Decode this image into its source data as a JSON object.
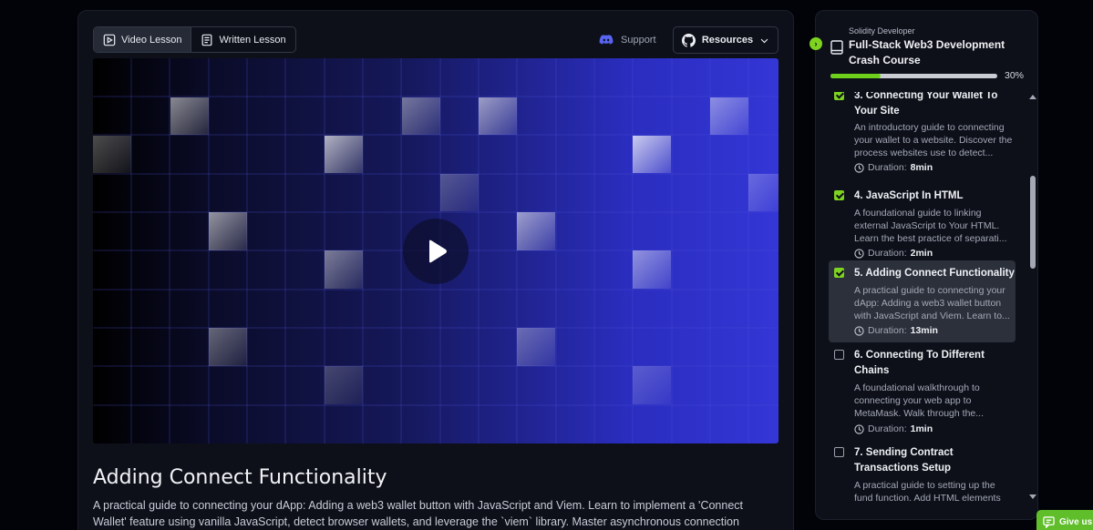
{
  "tabs": [
    {
      "label": "Video Lesson",
      "icon": "video-icon",
      "active": true
    },
    {
      "label": "Written Lesson",
      "icon": "document-icon",
      "active": false
    }
  ],
  "header_actions": {
    "support_label": "Support",
    "resources_label": "Resources"
  },
  "video": {
    "play_icon": "play-icon"
  },
  "lesson": {
    "title": "Adding Connect Functionality",
    "description": "A practical guide to connecting your dApp: Adding a web3 wallet button with JavaScript and Viem. Learn to implement a 'Connect Wallet' feature using vanilla JavaScript, detect browser wallets, and leverage the `viem` library. Master asynchronous connection requests with..."
  },
  "course": {
    "subtitle": "Solidity Developer",
    "title": "Full-Stack Web3 Development Crash Course",
    "progress_percent": 30,
    "progress_label": "30%"
  },
  "lessons": [
    {
      "title": "3. Connecting Your Wallet To Your Site",
      "description": "An introductory guide to connecting your wallet to a website. Discover the process websites use to detect...",
      "duration_label": "Duration:",
      "duration": "8min",
      "completed": true,
      "active": false
    },
    {
      "title": "4. JavaScript In HTML",
      "description": "A foundational guide to linking external JavaScript to Your HTML. Learn the best practice of separati...",
      "duration_label": "Duration:",
      "duration": "2min",
      "completed": true,
      "active": false
    },
    {
      "title": "5. Adding Connect Functionality",
      "description": "A practical guide to connecting your dApp: Adding a web3 wallet button with JavaScript and Viem. Learn to...",
      "duration_label": "Duration:",
      "duration": "13min",
      "completed": true,
      "active": true
    },
    {
      "title": "6. Connecting To Different Chains",
      "description": "A foundational walkthrough to connecting your web app to MetaMask. Walk through the...",
      "duration_label": "Duration:",
      "duration": "1min",
      "completed": false,
      "active": false
    },
    {
      "title": "7. Sending Contract Transactions Setup",
      "description": "A practical guide to setting up the fund function. Add HTML elements",
      "duration_label": "",
      "duration": "",
      "completed": false,
      "active": false
    }
  ],
  "feedback": {
    "label": "Give us f"
  },
  "colors": {
    "accent_green": "#7dd320",
    "panel_bg": "#0d1019",
    "video_blue": "#3436d6"
  }
}
